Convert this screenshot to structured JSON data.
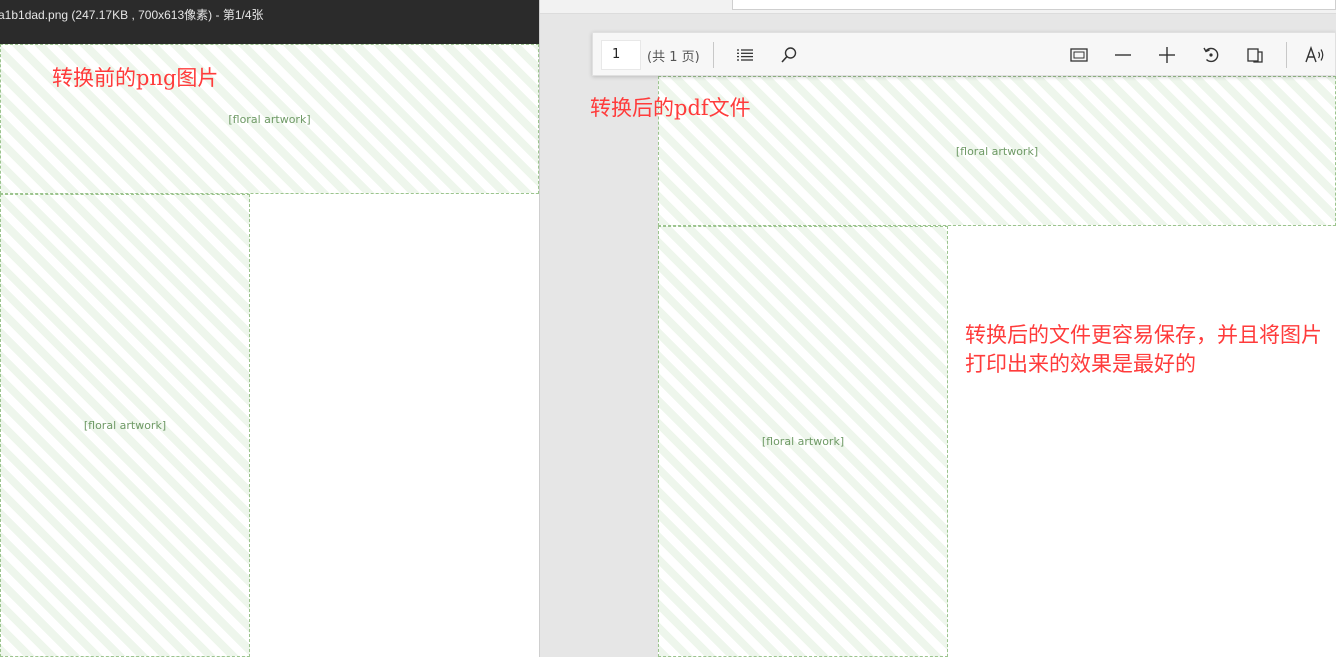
{
  "image_viewer": {
    "title": "a1b1dad.png (247.17KB , 700x613像素) - 第1/4张",
    "caption": "转换前的png图片"
  },
  "pdf_viewer": {
    "page_number": "1",
    "page_count": "(共 1 页)",
    "caption": "转换后的pdf文件",
    "note": "转换后的文件更容易保存，并且将图片打印出来的效果是最好的",
    "icons": [
      "table-of-contents-icon",
      "search-icon",
      "fit-page-icon",
      "zoom-out-icon",
      "zoom-in-icon",
      "rotate-icon",
      "page-view-icon",
      "read-aloud-icon"
    ]
  },
  "colors": {
    "annotation_red": "#ff3b3b",
    "viewer_titlebar": "#2b2b2b",
    "pdf_background": "#e6e6e6",
    "toolbar": "#f7f7f7"
  }
}
